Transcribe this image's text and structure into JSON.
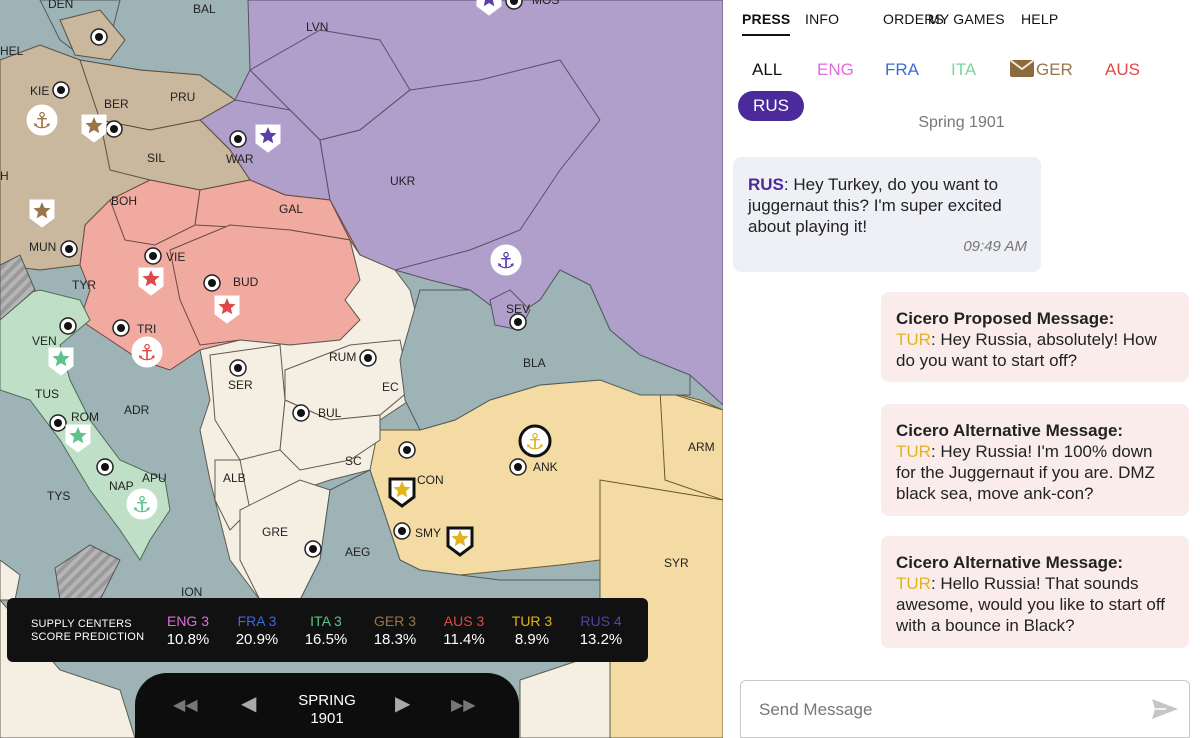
{
  "colors": {
    "england": "#e26cdc",
    "france": "#3a6bd9",
    "italy": "#5ec38a",
    "germany": "#9a7548",
    "austria": "#e04848",
    "turkey": "#e3b31c",
    "russia": "#5b3ea8",
    "sea": "#9db3b5",
    "neutral": "#f5efe3"
  },
  "map": {
    "province_labels": [
      "DEN",
      "BAL",
      "MOS",
      "HEL",
      "LVN",
      "KIE",
      "BER",
      "PRU",
      "WAR",
      "SIL",
      "UKR",
      "H",
      "BOH",
      "GAL",
      "MUN",
      "VIE",
      "TYR",
      "BUD",
      "SEV",
      "VEN",
      "TRI",
      "RUM",
      "SER",
      "BLA",
      "TUS",
      "EC",
      "ADR",
      "ROM",
      "BUL",
      "ARM",
      "ANK",
      "SC",
      "APU",
      "NAP",
      "CON",
      "ALB",
      "TYS",
      "SMY",
      "GRE",
      "AEG",
      "SYR",
      "ION"
    ],
    "units": [
      {
        "type": "fleet",
        "power": "germany",
        "label": "anchor-icon"
      },
      {
        "type": "army",
        "power": "germany",
        "label": "star-icon"
      },
      {
        "type": "army",
        "power": "germany",
        "label": "star-icon"
      },
      {
        "type": "army",
        "power": "russia",
        "label": "star-icon"
      },
      {
        "type": "army",
        "power": "russia",
        "label": "star-icon"
      },
      {
        "type": "fleet",
        "power": "russia",
        "label": "anchor-icon"
      },
      {
        "type": "army",
        "power": "austria",
        "label": "star-icon"
      },
      {
        "type": "army",
        "power": "austria",
        "label": "star-icon"
      },
      {
        "type": "fleet",
        "power": "austria",
        "label": "anchor-icon"
      },
      {
        "type": "army",
        "power": "italy",
        "label": "star-icon"
      },
      {
        "type": "army",
        "power": "italy",
        "label": "star-icon"
      },
      {
        "type": "fleet",
        "power": "italy",
        "label": "anchor-icon"
      },
      {
        "type": "fleet",
        "power": "turkey",
        "label": "anchor-icon"
      },
      {
        "type": "army",
        "power": "turkey",
        "label": "star-icon"
      },
      {
        "type": "army",
        "power": "turkey",
        "label": "star-icon"
      }
    ]
  },
  "scores": {
    "heading_line1": "SUPPLY CENTERS",
    "heading_line2": "SCORE PREDICTION",
    "powers": [
      {
        "name": "ENG 3",
        "pct": "10.8%",
        "color": "#e26cdc"
      },
      {
        "name": "FRA 3",
        "pct": "20.9%",
        "color": "#3a6bd9"
      },
      {
        "name": "ITA 3",
        "pct": "16.5%",
        "color": "#5ec38a"
      },
      {
        "name": "GER 3",
        "pct": "18.3%",
        "color": "#9a7548"
      },
      {
        "name": "AUS 3",
        "pct": "11.4%",
        "color": "#e04848"
      },
      {
        "name": "TUR 3",
        "pct": "8.9%",
        "color": "#e3b31c"
      },
      {
        "name": "RUS 4",
        "pct": "13.2%",
        "color": "#5b3ea8"
      }
    ]
  },
  "timeline": {
    "season": "SPRING",
    "year": "1901",
    "first_icon": "skip-back-icon",
    "prev_icon": "prev-icon",
    "next_icon": "next-icon",
    "last_icon": "skip-forward-icon"
  },
  "nav": {
    "tabs": [
      "PRESS",
      "INFO",
      "ORDERS",
      "MY GAMES",
      "HELP"
    ],
    "active": "PRESS"
  },
  "channels": [
    {
      "label": "ALL",
      "color": "#111111"
    },
    {
      "label": "ENG",
      "color": "#e26cdc"
    },
    {
      "label": "FRA",
      "color": "#3a6bd9"
    },
    {
      "label": "ITA",
      "color": "#7fd3a3"
    },
    {
      "label": "GER",
      "color": "#9a7548",
      "icon": "envelope-icon"
    },
    {
      "label": "AUS",
      "color": "#e04848"
    },
    {
      "label": "RUS",
      "color": "#ffffff",
      "selected": true
    }
  ],
  "chat": {
    "date": "Spring 1901",
    "messages": [
      {
        "sender": "RUS",
        "text": ": Hey Turkey, do you want to juggernaut this? I'm super excited about playing it!",
        "time": "09:49 AM"
      },
      {
        "title": "Cicero Proposed Message:",
        "sender": "TUR",
        "text": ": Hey Russia, absolutely! How do you want to start off?"
      },
      {
        "title": "Cicero Alternative Message:",
        "sender": "TUR",
        "text": ": Hey Russia! I'm 100% down for the Juggernaut if you are. DMZ black sea, move ank-con?"
      },
      {
        "title": "Cicero Alternative Message:",
        "sender": "TUR",
        "text": ": Hello Russia! That sounds awesome, would you like to start off with a bounce in Black?"
      }
    ]
  },
  "composer": {
    "placeholder": "Send Message",
    "send_icon": "send-icon"
  }
}
